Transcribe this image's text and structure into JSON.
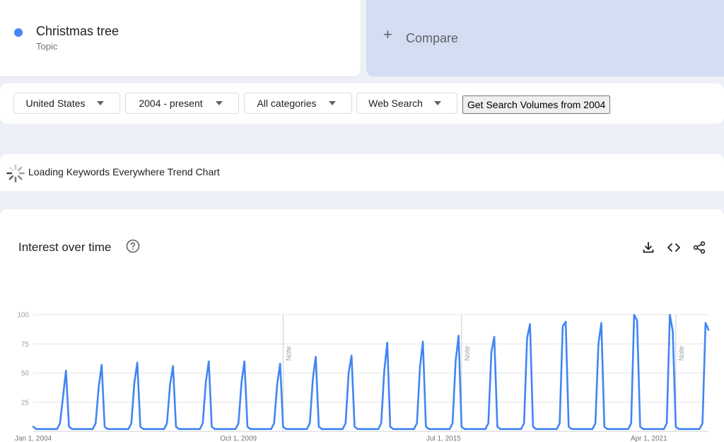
{
  "term": {
    "name": "Christmas tree",
    "type": "Topic",
    "color": "#4285f4"
  },
  "compare": {
    "label": "Compare"
  },
  "filters": [
    {
      "label": "United States"
    },
    {
      "label": "2004 - present"
    },
    {
      "label": "All categories"
    },
    {
      "label": "Web Search"
    }
  ],
  "search_volumes_button": "Get Search Volumes from 2004",
  "loading_text": "Loading Keywords Everywhere Trend Chart",
  "chart_section": {
    "title": "Interest over time",
    "icons": [
      "help-icon",
      "download-icon",
      "embed-icon",
      "share-icon"
    ]
  },
  "chart_data": {
    "type": "line",
    "title": "Interest over time",
    "xlabel": "",
    "ylabel": "",
    "x_range": [
      "2004-01-01",
      "2022-12-01"
    ],
    "ylim": [
      0,
      100
    ],
    "yticks": [
      25,
      50,
      75,
      100
    ],
    "xticks": [
      {
        "date": "2004-01-01",
        "label": "Jan 1, 2004"
      },
      {
        "date": "2009-10-01",
        "label": "Oct 1, 2009"
      },
      {
        "date": "2015-07-01",
        "label": "Jul 1, 2015"
      },
      {
        "date": "2021-04-01",
        "label": "Apr 1, 2021"
      }
    ],
    "notes": [
      {
        "date": "2011-01-01",
        "label": "Note"
      },
      {
        "date": "2016-01-01",
        "label": "Note"
      },
      {
        "date": "2022-01-01",
        "label": "Note"
      }
    ],
    "grid": true,
    "series": [
      {
        "color": "#4285f4",
        "yearly_peaks": [
          {
            "year": 2004,
            "nov": 30,
            "dec": 52
          },
          {
            "year": 2005,
            "nov": 38,
            "dec": 57
          },
          {
            "year": 2006,
            "nov": 42,
            "dec": 59
          },
          {
            "year": 2007,
            "nov": 40,
            "dec": 56
          },
          {
            "year": 2008,
            "nov": 42,
            "dec": 60
          },
          {
            "year": 2009,
            "nov": 42,
            "dec": 60
          },
          {
            "year": 2010,
            "nov": 40,
            "dec": 58
          },
          {
            "year": 2011,
            "nov": 45,
            "dec": 64
          },
          {
            "year": 2012,
            "nov": 50,
            "dec": 65
          },
          {
            "year": 2013,
            "nov": 52,
            "dec": 76
          },
          {
            "year": 2014,
            "nov": 55,
            "dec": 77
          },
          {
            "year": 2015,
            "nov": 60,
            "dec": 82
          },
          {
            "year": 2016,
            "nov": 68,
            "dec": 81
          },
          {
            "year": 2017,
            "nov": 80,
            "dec": 92
          },
          {
            "year": 2018,
            "nov": 90,
            "dec": 94
          },
          {
            "year": 2019,
            "nov": 75,
            "dec": 93
          },
          {
            "year": 2020,
            "nov": 100,
            "dec": 95
          },
          {
            "year": 2021,
            "nov": 100,
            "dec": 86
          },
          {
            "year": 2022,
            "nov": 93,
            "dec": 87
          }
        ],
        "offseason_level": 2
      }
    ]
  }
}
